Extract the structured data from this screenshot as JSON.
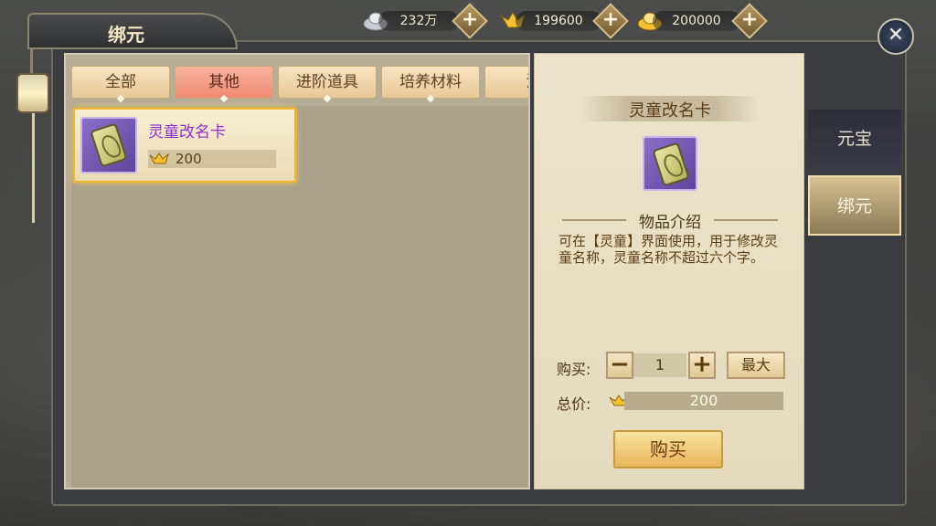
{
  "currency": [
    {
      "icon": "silver-ingot-icon",
      "value": "232万"
    },
    {
      "icon": "gold-ingot-icon",
      "value": "199600"
    },
    {
      "icon": "yuanbao-icon",
      "value": "200000"
    }
  ],
  "plus_glyph": "+",
  "window": {
    "title": "绑元",
    "close_glyph": "✕"
  },
  "tabs": [
    "全部",
    "其他",
    "进阶道具",
    "培养材料",
    "消"
  ],
  "active_tab": "其他",
  "items": [
    {
      "name": "灵童改名卡",
      "price": "200",
      "icon": "rename-card-icon"
    }
  ],
  "detail": {
    "title": "灵童改名卡",
    "section_title": "物品介绍",
    "description": "可在【灵童】界面使用，用于修改灵童名称，灵童名称不超过六个字。",
    "buy_label": "购买:",
    "quantity": "1",
    "minus_glyph": "−",
    "plus_glyph": "+",
    "max_label": "最大",
    "total_label": "总价:",
    "total_value": "200",
    "buy_button": "购买"
  },
  "side_tabs": [
    "元宝",
    "绑元"
  ],
  "active_side_tab": "绑元",
  "colors": {
    "accent_gold": "#f0b72e",
    "item_name": "#8e2fd0",
    "active_tab": "#f08a73"
  }
}
